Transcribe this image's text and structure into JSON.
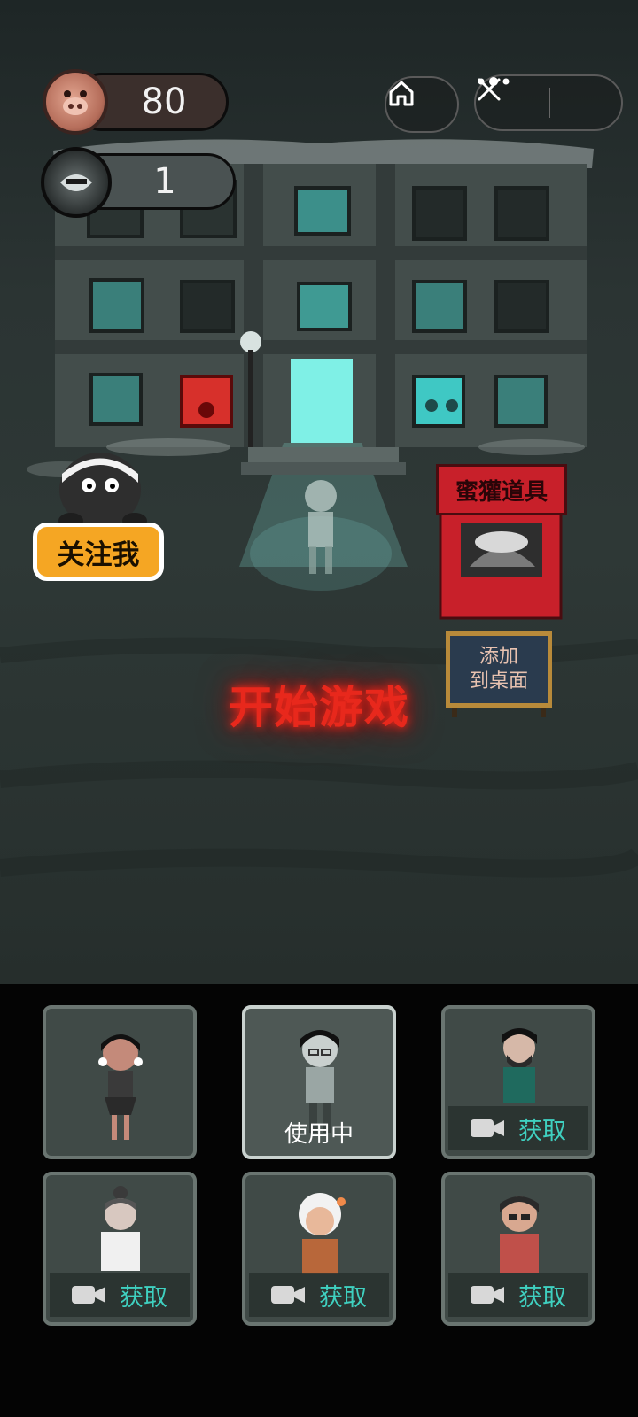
{
  "hud": {
    "coins": "80",
    "lives": "1"
  },
  "top_buttons": {
    "home_icon": "home-icon",
    "more_icon": "more-dots-icon",
    "close_icon": "close-icon"
  },
  "follow": {
    "label": "关注我"
  },
  "shop": {
    "sign": "蜜獾道具"
  },
  "desktop": {
    "line1": "添加",
    "line2": "到桌面"
  },
  "start": {
    "label": "开始游戏"
  },
  "characters": [
    {
      "status": "",
      "action": ""
    },
    {
      "status": "使用中",
      "action": ""
    },
    {
      "status": "",
      "action": "获取"
    },
    {
      "status": "",
      "action": "获取"
    },
    {
      "status": "",
      "action": "获取"
    },
    {
      "status": "",
      "action": "获取"
    }
  ],
  "colors": {
    "accent_red": "#e8281c",
    "follow_orange": "#f5a623",
    "get_teal": "#3fd0c0"
  }
}
